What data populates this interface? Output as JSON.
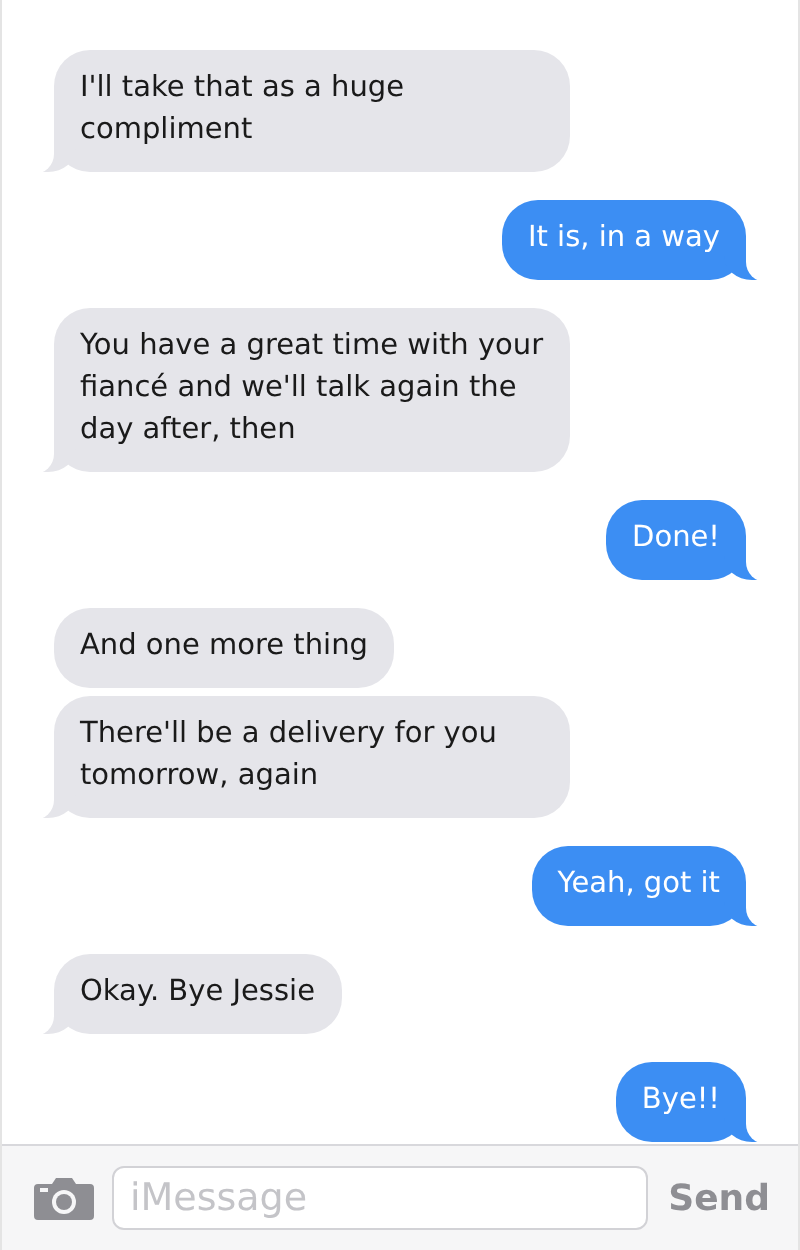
{
  "messages": [
    {
      "kind": "received",
      "text": "I'll take that as a huge compliment",
      "tail": true
    },
    {
      "kind": "sent",
      "text": "It is, in a way",
      "tail": true
    },
    {
      "kind": "received",
      "text": "You have a great time with your fiancé and we'll talk again the day after, then",
      "tail": true
    },
    {
      "kind": "sent",
      "text": "Done!",
      "tail": true
    },
    {
      "kind": "received",
      "text": "And one more thing",
      "tail": false
    },
    {
      "kind": "received",
      "text": "There'll be a delivery for you tomorrow, again",
      "tail": true
    },
    {
      "kind": "sent",
      "text": "Yeah, got it",
      "tail": true
    },
    {
      "kind": "received",
      "text": "Okay. Bye Jessie",
      "tail": true
    },
    {
      "kind": "sent",
      "text": "Bye!!",
      "tail": true
    }
  ],
  "composer": {
    "placeholder": "iMessage",
    "send_label": "Send",
    "send_disabled": true
  }
}
